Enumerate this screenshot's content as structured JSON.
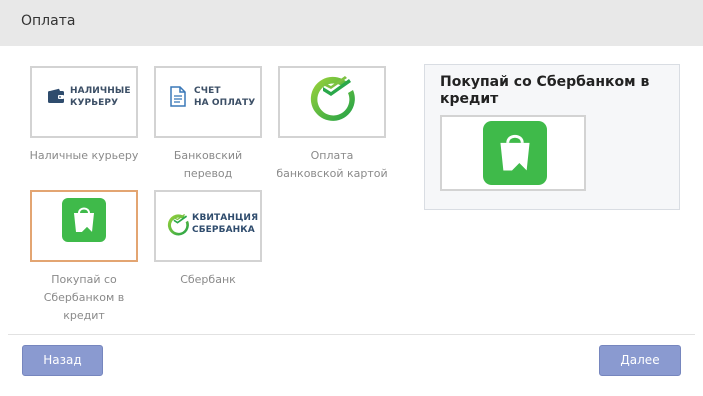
{
  "header": {
    "title": "Оплата"
  },
  "methods": [
    {
      "caption": "Наличные курьеру",
      "tile_line1": "НАЛИЧНЫЕ",
      "tile_line2": "КУРЬЕРУ",
      "icon": "wallet-icon"
    },
    {
      "caption": "Банковский перевод",
      "tile_line1": "СЧЕТ",
      "tile_line2": "НА ОПЛАТУ",
      "icon": "invoice-document-icon"
    },
    {
      "caption": "Оплата банковской картой",
      "icon": "sberbank-logo-icon"
    },
    {
      "caption": "Покупай со Сбербанком в кредит",
      "icon": "shopping-bag-icon",
      "selected": true
    },
    {
      "caption": "Сбербанк",
      "tile_line1": "КВИТАНЦИЯ",
      "tile_line2": "СБЕРБАНКА",
      "icon": "sberbank-logo-icon"
    }
  ],
  "promo": {
    "title": "Покупай со Сбербанком в кредит",
    "icon": "shopping-bag-icon"
  },
  "footer": {
    "back_label": "Назад",
    "next_label": "Далее"
  },
  "colors": {
    "accent_button": "#8a9ad0",
    "selected_border": "#e3a572",
    "sber_green": "#3fba4a",
    "tile_text": "#3c4f66"
  }
}
